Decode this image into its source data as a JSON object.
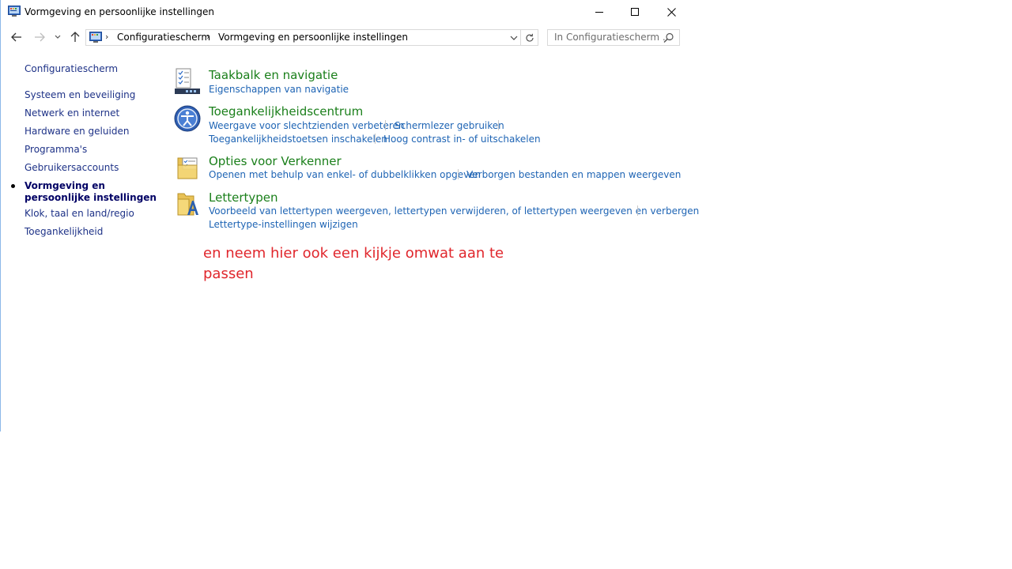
{
  "window": {
    "title": "Vormgeving en persoonlijke instellingen"
  },
  "address": {
    "crumbs": [
      "Configuratiescherm",
      "Vormgeving en persoonlijke instellingen"
    ],
    "separator": "›"
  },
  "search": {
    "placeholder": "In Configuratiescherm ..."
  },
  "sidebar": {
    "home": "Configuratiescherm",
    "items": [
      {
        "label": "Systeem en beveiliging"
      },
      {
        "label": "Netwerk en internet"
      },
      {
        "label": "Hardware en geluiden"
      },
      {
        "label": "Programma's"
      },
      {
        "label": "Gebruikersaccounts"
      },
      {
        "label": "Vormgeving en persoonlijke instellingen",
        "active": true
      },
      {
        "label": "Klok, taal en land/regio"
      },
      {
        "label": "Toegankelijkheid"
      }
    ]
  },
  "groups": [
    {
      "title": "Taakbalk en navigatie",
      "icon": "taskbar-icon",
      "links": [
        "Eigenschappen van navigatie"
      ]
    },
    {
      "title": "Toegankelijkheidscentrum",
      "icon": "ease-of-access-icon",
      "links": [
        "Weergave voor slechtzienden verbeteren",
        "Schermlezer gebruiken",
        "Toegankelijkheidstoetsen inschakelen",
        "Hoog contrast in- of uitschakelen"
      ]
    },
    {
      "title": "Opties voor Verkenner",
      "icon": "folder-options-icon",
      "links": [
        "Openen met behulp van enkel- of dubbelklikken opgeven",
        "Verborgen bestanden en mappen weergeven"
      ]
    },
    {
      "title": "Lettertypen",
      "icon": "fonts-folder-icon",
      "links": [
        "Voorbeeld van lettertypen weergeven, lettertypen verwijderen, of lettertypen weergeven en verbergen",
        "Lettertype-instellingen wijzigen"
      ]
    }
  ],
  "annotation": "en neem hier ook een kijkje omwat aan te passen",
  "colors": {
    "group_title": "#1a7f1a",
    "task_link": "#1e64b4",
    "nav_link": "#1e3287",
    "annotation": "#e0262c"
  }
}
